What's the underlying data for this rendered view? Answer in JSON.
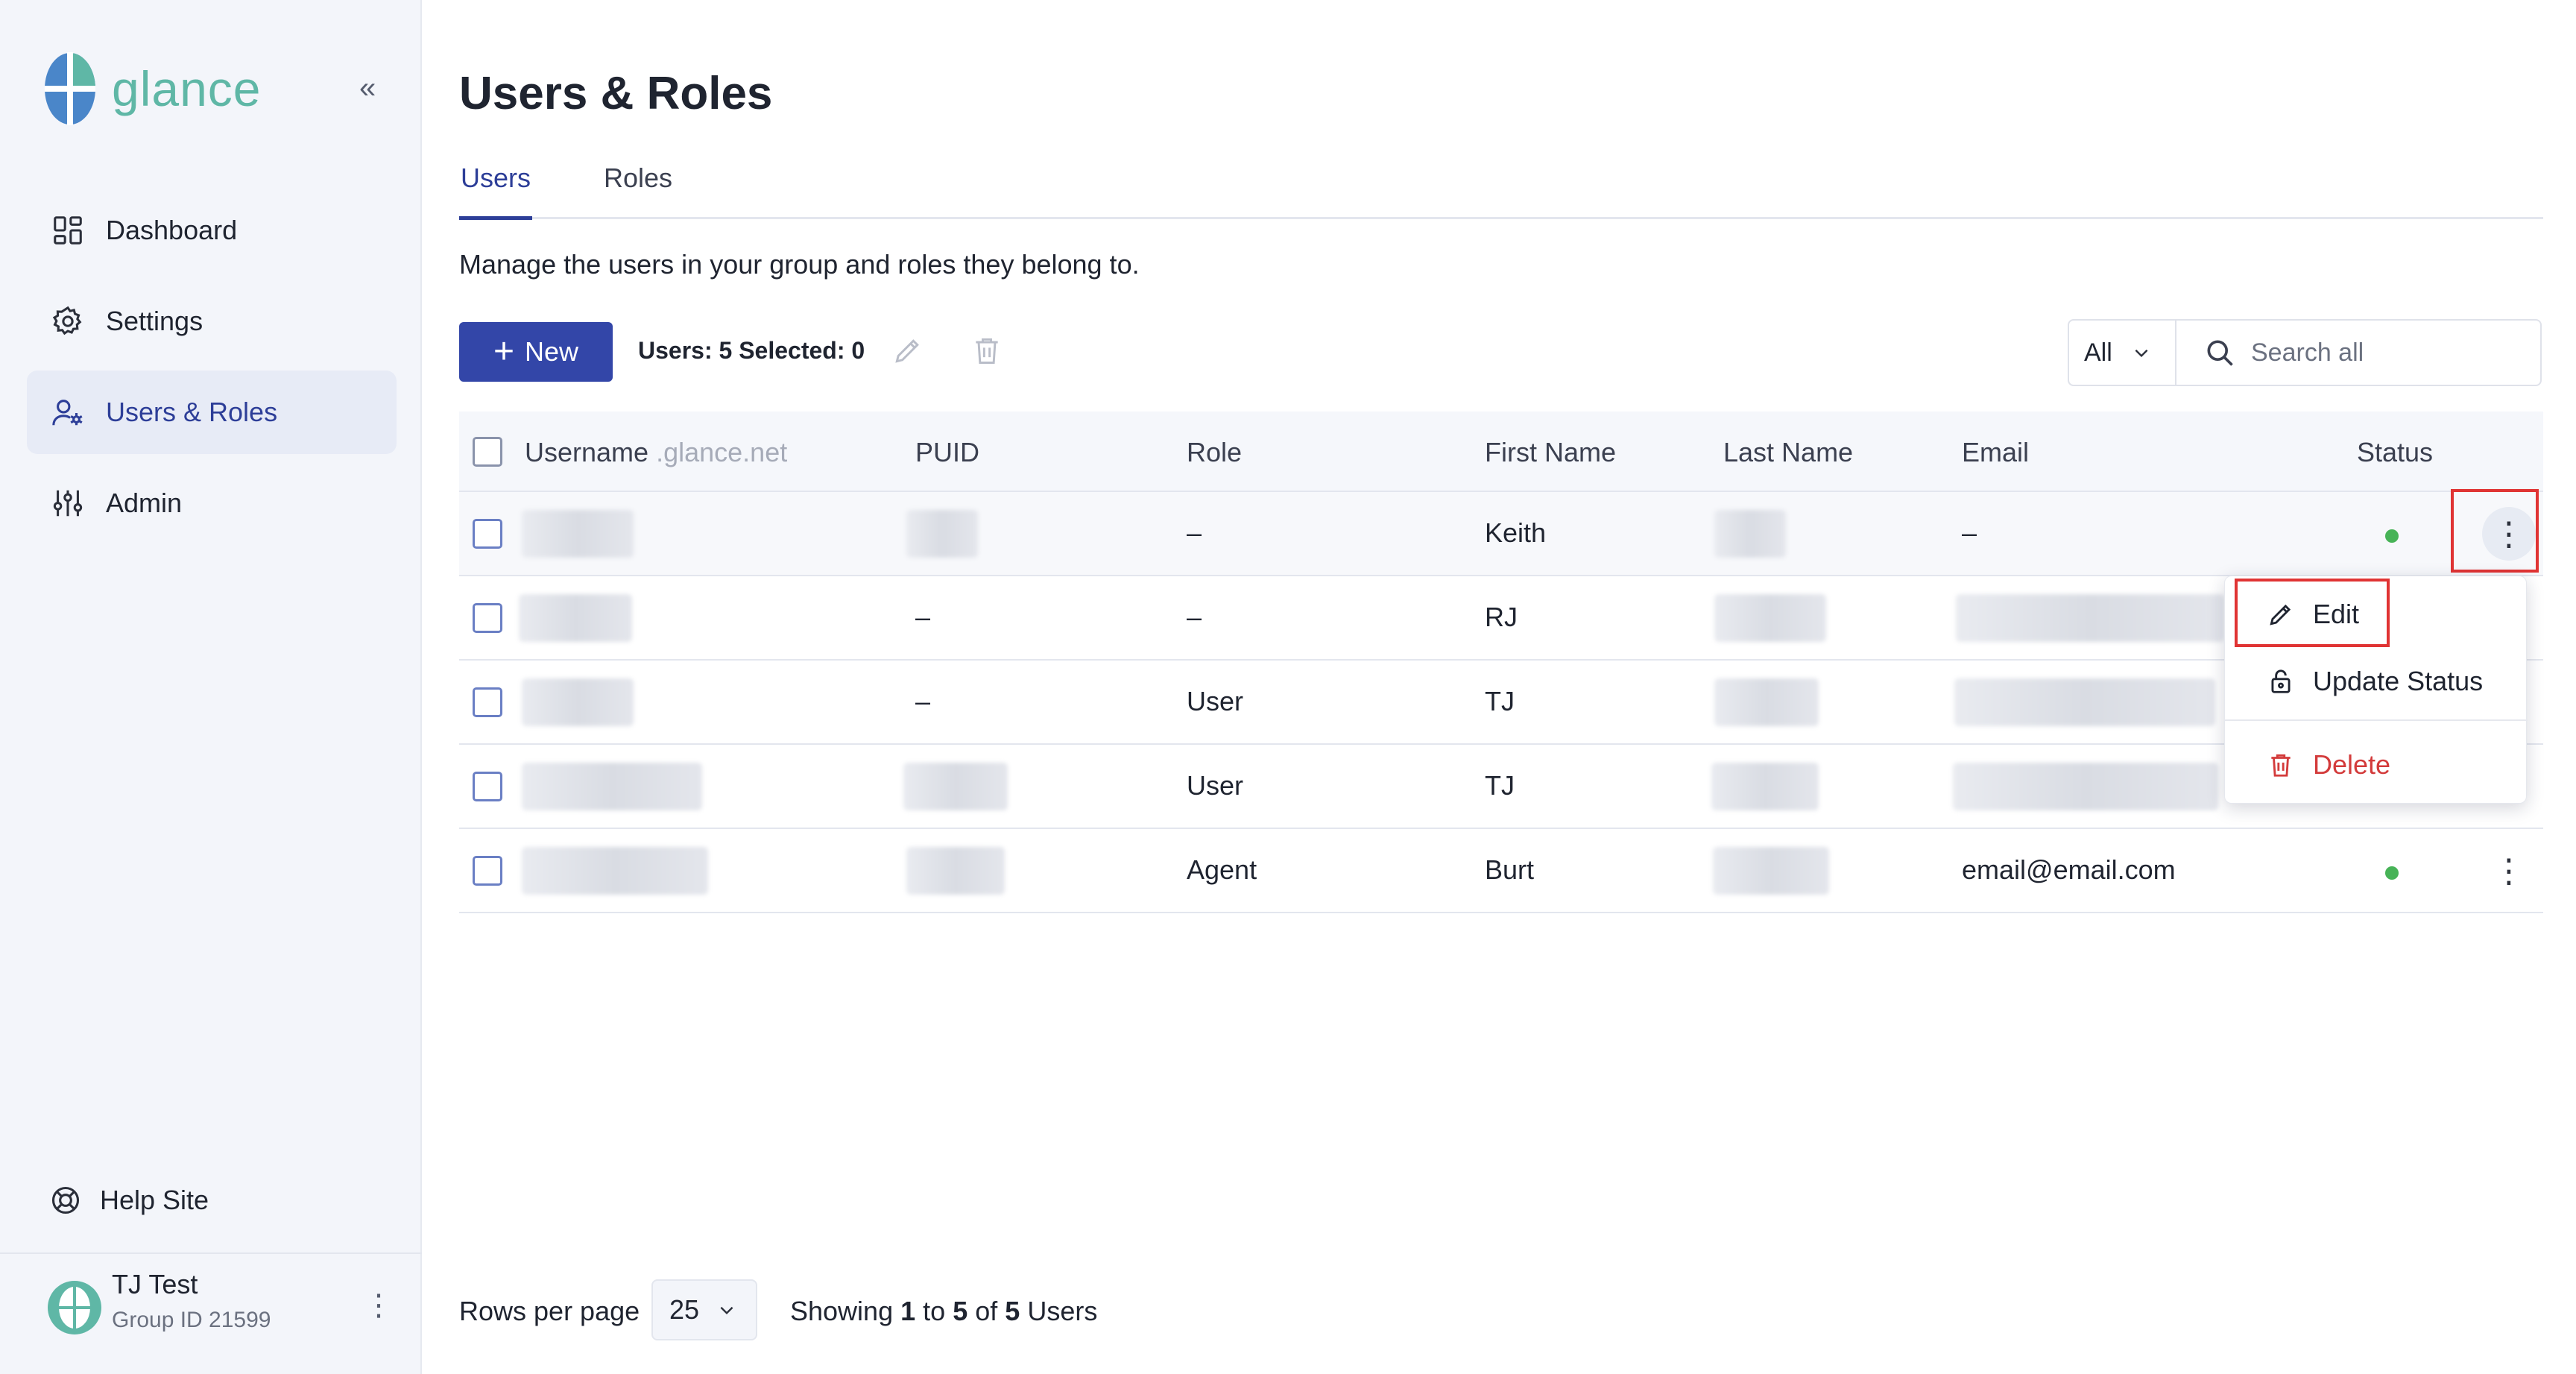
{
  "app": {
    "logo_text": "glance",
    "collapse_glyph": "«"
  },
  "sidebar": {
    "items": [
      {
        "label": "Dashboard",
        "icon": "dashboard-icon"
      },
      {
        "label": "Settings",
        "icon": "gear-icon"
      },
      {
        "label": "Users & Roles",
        "icon": "users-icon",
        "active": true
      },
      {
        "label": "Admin",
        "icon": "sliders-icon"
      }
    ],
    "help_label": "Help Site",
    "user": {
      "name": "TJ Test",
      "group": "Group ID 21599"
    }
  },
  "page": {
    "title": "Users & Roles",
    "tabs": [
      "Users",
      "Roles"
    ],
    "description": "Manage the users in your group and roles they belong to."
  },
  "toolbar": {
    "new_label": "New",
    "counts": "Users: 5 Selected: 0",
    "filter_value": "All",
    "search_placeholder": "Search all"
  },
  "table": {
    "headers": {
      "username": "Username",
      "username_suffix": ".glance.net",
      "puid": "PUID",
      "role": "Role",
      "first_name": "First Name",
      "last_name": "Last Name",
      "email": "Email",
      "status": "Status"
    },
    "rows": [
      {
        "puid": "",
        "role": "–",
        "first_name": "Keith",
        "email": "–"
      },
      {
        "puid": "–",
        "role": "–",
        "first_name": "RJ",
        "email": ""
      },
      {
        "puid": "–",
        "role": "User",
        "first_name": "TJ",
        "email": ""
      },
      {
        "puid": "",
        "role": "User",
        "first_name": "TJ",
        "email": ""
      },
      {
        "puid": "",
        "role": "Agent",
        "first_name": "Burt",
        "email": "email@email.com"
      }
    ],
    "status_color": "#47b357"
  },
  "row_menu": {
    "edit": "Edit",
    "update_status": "Update Status",
    "delete": "Delete",
    "delete_color": "#d33b3b"
  },
  "footer": {
    "rows_per_page_label": "Rows per page",
    "rows_per_page_value": "25",
    "showing_prefix": "Showing",
    "showing_from": "1",
    "showing_to_word": "to",
    "showing_to": "5",
    "showing_of_word": "of",
    "showing_total": "5",
    "showing_suffix": "Users"
  },
  "colors": {
    "accent": "#3346a8",
    "brand": "#5fb7a6",
    "annotation": "#e03434"
  }
}
